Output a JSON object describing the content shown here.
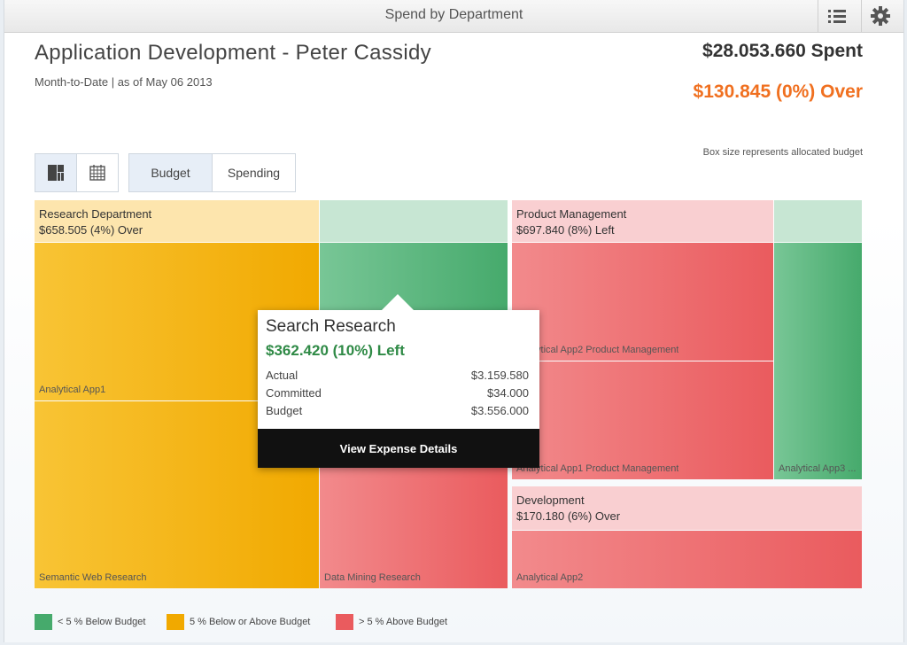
{
  "window": {
    "title": "Spend by Department"
  },
  "header": {
    "title": "Application Development - Peter Cassidy",
    "subtitle": "Month-to-Date | as of May 06 2013",
    "spent": "$28.053.660 Spent",
    "over": "$130.845 (0%) Over"
  },
  "toolbar": {
    "view_buttons": [
      {
        "icon": "treemap-icon"
      },
      {
        "icon": "table-grid-icon"
      }
    ],
    "mode_tabs": [
      {
        "label": "Budget",
        "selected": true
      },
      {
        "label": "Spending",
        "selected": false
      }
    ],
    "note": "Box size represents allocated budget"
  },
  "treemap": {
    "research": {
      "name": "Research Department",
      "status": "$658.505 (4%) Over",
      "leaves": [
        "Analytical App1",
        "Semantic Web Research",
        "Data Mining Research"
      ]
    },
    "product": {
      "name": "Product Management",
      "status": "$697.840 (8%) Left",
      "leaves": [
        "Analytical App2 Product Management",
        "Analytical App1 Product Management",
        "Analytical App3 ..."
      ]
    },
    "development": {
      "name": "Development",
      "status": "$170.180 (6%) Over",
      "leaves": [
        "Analytical App2"
      ]
    }
  },
  "tooltip": {
    "title": "Search Research",
    "status": "$362.420 (10%) Left",
    "rows": [
      {
        "label": "Actual",
        "value": "$3.159.580"
      },
      {
        "label": "Committed",
        "value": "$34.000"
      },
      {
        "label": "Budget",
        "value": "$3.556.000"
      }
    ],
    "action": "View Expense Details"
  },
  "legend": [
    {
      "label": "< 5 % Below Budget",
      "color": "#46aa6c"
    },
    {
      "label": "5 % Below or Above Budget",
      "color": "#f1a900"
    },
    {
      "label": "> 5 % Above Budget",
      "color": "#ea5b5e"
    }
  ]
}
